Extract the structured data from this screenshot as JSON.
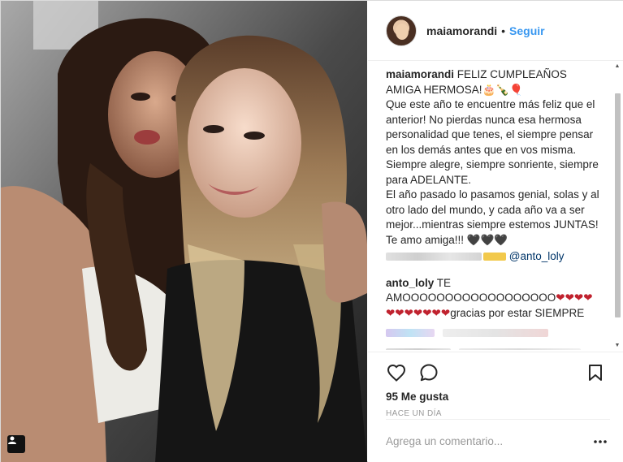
{
  "post": {
    "username": "maiamorandi",
    "follow_separator": "•",
    "follow_label": "Seguir",
    "accent_color": "#3897f0",
    "caption": {
      "username": "maiamorandi",
      "text_1": "FELIZ CUMPLEAÑOS AMIGA HERMOSA!",
      "emoji_1": "🎂🍾🎈",
      "text_2": "Que este año te encuentre más feliz que el anterior! No pierdas nunca esa hermosa personalidad que tenes, el siempre pensar en los demás antes que en vos misma. Siempre alegre, siempre sonriente, siempre para ADELANTE.",
      "text_3": "El año pasado lo pasamos genial, solas y al otro lado del mundo, y cada año va a ser mejor...mientras siempre estemos JUNTAS! Te amo amiga!!!",
      "hearts": "🖤🖤🖤",
      "mention": "@anto_loly"
    },
    "reply": {
      "username": "anto_loly",
      "text_1": "TE AMOOOOOOOOOOOOOOOOOO",
      "hearts_1": "❤❤❤❤",
      "hearts_2": "❤❤❤❤❤❤❤",
      "text_2": "gracias por estar SIEMPRE"
    },
    "likes": "95 Me gusta",
    "time_ago": "HACE UN DÍA",
    "comment_placeholder": "Agrega un comentario...",
    "more_label": "•••"
  },
  "icons": {
    "like": "heart-icon",
    "comment": "comment-icon",
    "save": "bookmark-icon",
    "more": "more-options-icon",
    "tagged": "user-tag-icon"
  }
}
